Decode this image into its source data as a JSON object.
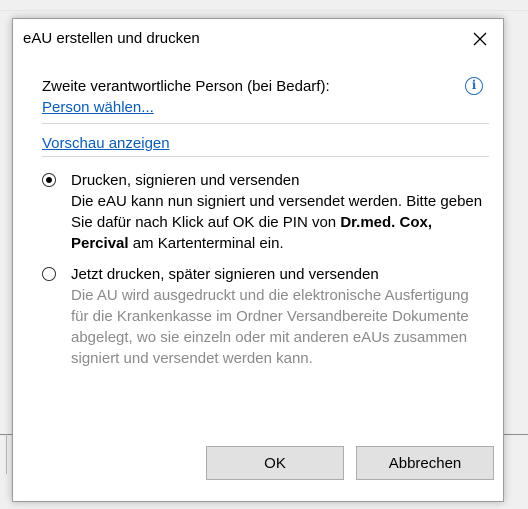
{
  "dialog": {
    "title": "eAU erstellen und drucken",
    "close_glyph": "×"
  },
  "person": {
    "label": "Zweite verantwortliche Person (bei Bedarf):",
    "link": "Person wählen...",
    "info_glyph": "i"
  },
  "preview_link": "Vorschau anzeigen",
  "options": [
    {
      "label": "Drucken, signieren und versenden",
      "checked": true,
      "desc_before": "Die eAU kann nun signiert und versendet werden. Bitte geben Sie dafür nach Klick auf OK die PIN von ",
      "desc_bold": "Dr.med. Cox, Percival",
      "desc_after": " am Kartenterminal ein."
    },
    {
      "label": "Jetzt drucken, später signieren und versenden",
      "checked": false,
      "desc": "Die AU wird ausgedruckt und die elektronische Ausfertigung für die Krankenkasse im Ordner Versandbereite Dokumente abgelegt, wo sie einzeln oder mit anderen eAUs zusammen signiert und versendet werden kann."
    }
  ],
  "buttons": {
    "ok": "OK",
    "cancel": "Abbrechen"
  },
  "colors": {
    "link": "#0a5cb5",
    "info": "#2b6cb5",
    "disabled_text": "#8a8a8a"
  }
}
